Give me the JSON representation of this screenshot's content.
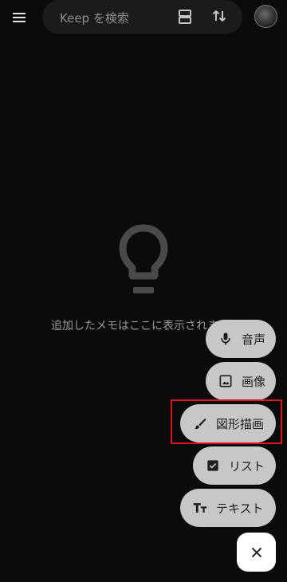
{
  "search": {
    "placeholder": "Keep を検索"
  },
  "empty_state": {
    "message": "追加したメモはここに表示されます"
  },
  "fab_menu": {
    "items": [
      {
        "label": "音声",
        "icon": "microphone-icon"
      },
      {
        "label": "画像",
        "icon": "image-icon"
      },
      {
        "label": "図形描画",
        "icon": "brush-icon"
      },
      {
        "label": "リスト",
        "icon": "checkbox-icon"
      },
      {
        "label": "テキスト",
        "icon": "text-format-icon"
      }
    ],
    "close_icon": "close-icon"
  },
  "colors": {
    "background": "#0b0b0b",
    "search_bar": "#1b1b1b",
    "fab_item": "#c7c7c7",
    "highlight": "#e0141a"
  }
}
